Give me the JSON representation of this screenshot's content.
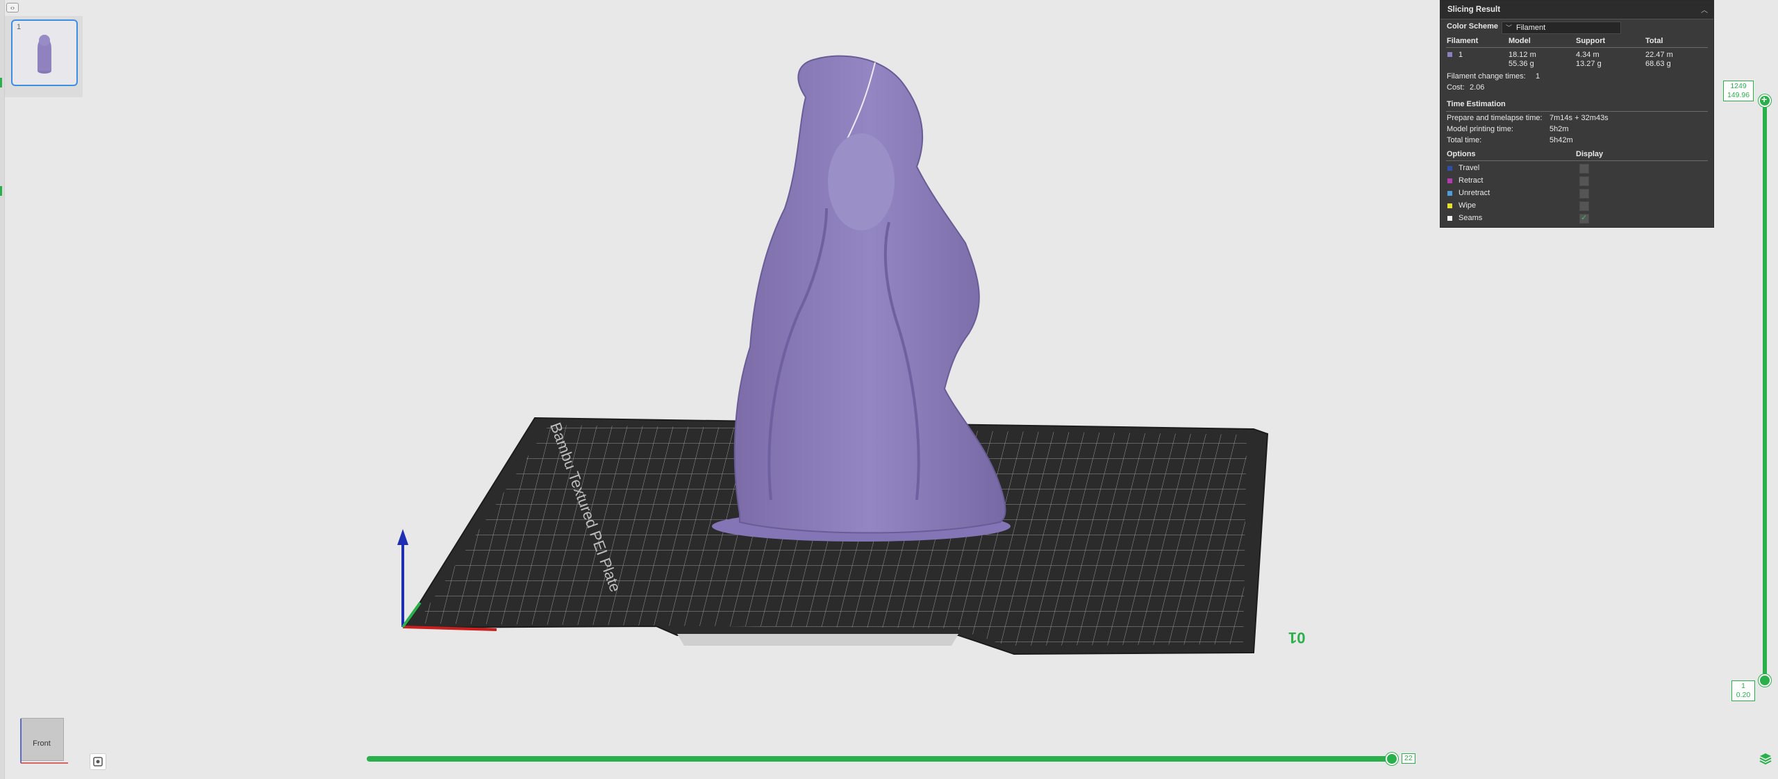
{
  "window": {
    "collapse_icon": "panel-toggle-icon"
  },
  "thumbnail": {
    "plate_number": "1"
  },
  "slicing_result": {
    "title": "Slicing Result",
    "color_scheme_label": "Color Scheme",
    "color_scheme_value": "Filament",
    "columns": {
      "filament": "Filament",
      "model": "Model",
      "support": "Support",
      "total": "Total"
    },
    "filament_row": {
      "index": "1",
      "color": "#8e7fbf",
      "model_length": "18.12 m",
      "model_weight": "55.36 g",
      "support_length": "4.34 m",
      "support_weight": "13.27 g",
      "total_length": "22.47 m",
      "total_weight": "68.63 g"
    },
    "filament_change_label": "Filament change times:",
    "filament_change_value": "1",
    "cost_label": "Cost:",
    "cost_value": "2.06",
    "time_title": "Time Estimation",
    "prepare_label": "Prepare and timelapse time:",
    "prepare_value": "7m14s + 32m43s",
    "model_time_label": "Model printing time:",
    "model_time_value": "5h2m",
    "total_time_label": "Total time:",
    "total_time_value": "5h42m",
    "options_label": "Options",
    "display_label": "Display",
    "options": [
      {
        "label": "Travel",
        "color": "#2f4fa8",
        "checked": false
      },
      {
        "label": "Retract",
        "color": "#b43bb3",
        "checked": false
      },
      {
        "label": "Unretract",
        "color": "#4f9fd6",
        "checked": false
      },
      {
        "label": "Wipe",
        "color": "#e8e12a",
        "checked": false
      },
      {
        "label": "Seams",
        "color": "#f2f2f2",
        "checked": true
      }
    ]
  },
  "layer_slider": {
    "top_layer": "1249",
    "top_height": "149.96",
    "bottom_layer": "1",
    "bottom_height": "0.20"
  },
  "move_slider": {
    "value": "22"
  },
  "plate": {
    "label": "01",
    "bed_text": "Bambu Textured PEI Plate"
  },
  "viewcube": {
    "face_label": "Front"
  },
  "colors": {
    "accent": "#2ab04a",
    "model": "#8e7fbf",
    "bed": "#2d2d2d"
  }
}
